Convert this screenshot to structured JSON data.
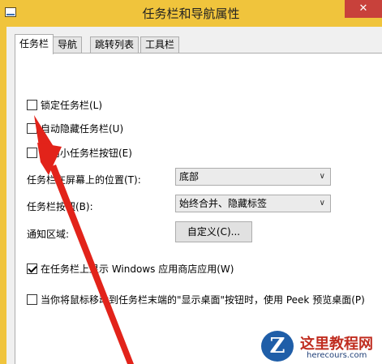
{
  "window": {
    "title": "任务栏和导航属性",
    "close_label": "✕"
  },
  "tabs": [
    {
      "label": "任务栏",
      "active": true
    },
    {
      "label": "导航",
      "active": false
    },
    {
      "label": "跳转列表",
      "active": false
    },
    {
      "label": "工具栏",
      "active": false
    }
  ],
  "taskbar": {
    "lock": {
      "label": "锁定任务栏(L)",
      "checked": false
    },
    "autohide": {
      "label": "自动隐藏任务栏(U)",
      "checked": false
    },
    "small_buttons": {
      "label": "使用小任务栏按钮(E)",
      "checked": false
    },
    "position": {
      "label": "任务栏在屏幕上的位置(T):",
      "value": "底部"
    },
    "buttons": {
      "label": "任务栏按钮(B):",
      "value": "始终合并、隐藏标签"
    },
    "notification": {
      "label": "通知区域:",
      "button_label": "自定义(C)..."
    },
    "store_apps": {
      "label": "在任务栏上显示 Windows 应用商店应用(W)",
      "checked": true
    },
    "peek": {
      "label": "当你将鼠标移动到任务栏末端的\"显示桌面\"按钮时，使用 Peek 预览桌面(P)",
      "checked": false
    }
  },
  "watermark": {
    "logo_letter": "Z",
    "name": "这里教程网",
    "url": "herecours.com"
  },
  "colors": {
    "accent": "#f0c43c",
    "arrow": "#e2231a",
    "close": "#c8413b"
  }
}
